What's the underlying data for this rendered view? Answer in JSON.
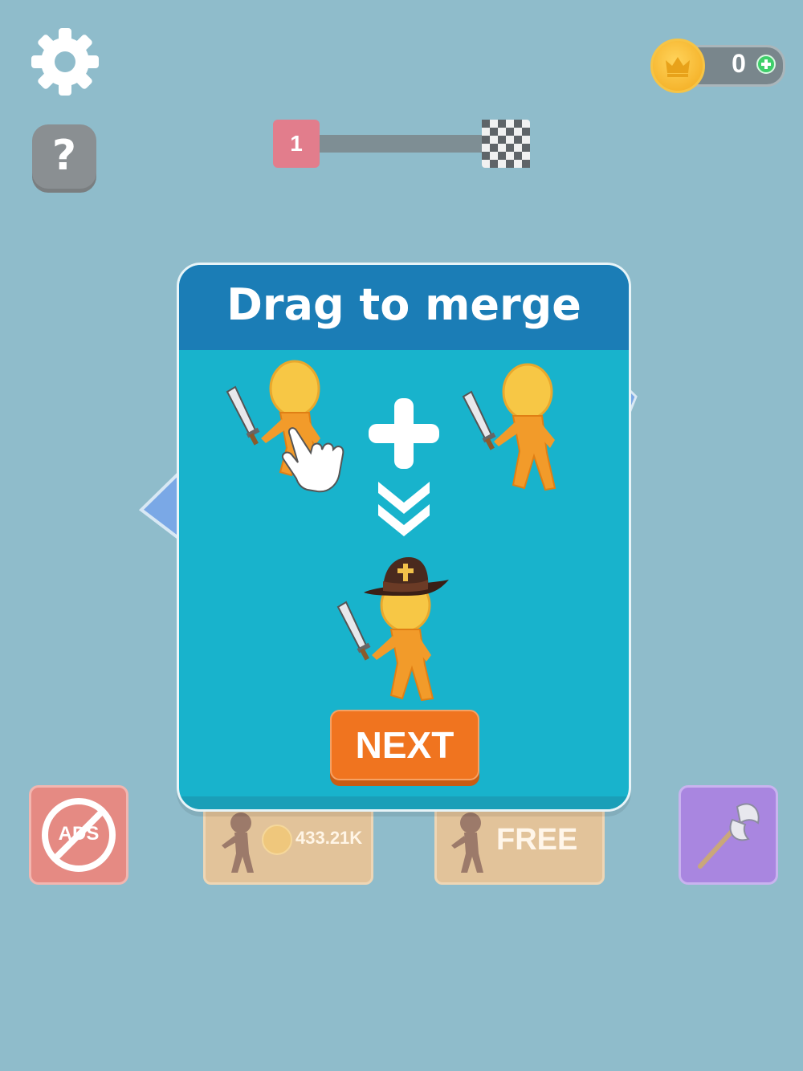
{
  "hud": {
    "help_label": "?",
    "coins": "0",
    "level": "1",
    "progress": 0
  },
  "modal": {
    "title": "Drag to merge",
    "next_label": "NEXT"
  },
  "shop": {
    "no_ads_label": "ADS",
    "buy_price": "433.21K",
    "free_label": "FREE"
  },
  "colors": {
    "background": "#8fbccb",
    "modal_header": "#1b7db6",
    "modal_body": "#18b3cc",
    "next_button": "#f0741f"
  },
  "icons": [
    "gear-icon",
    "question-icon",
    "coin-icon",
    "plus-icon",
    "checkered-flag-icon",
    "no-ads-icon",
    "hero-silhouette-icon",
    "axe-icon",
    "hand-pointer-icon",
    "chevron-down-icon"
  ]
}
